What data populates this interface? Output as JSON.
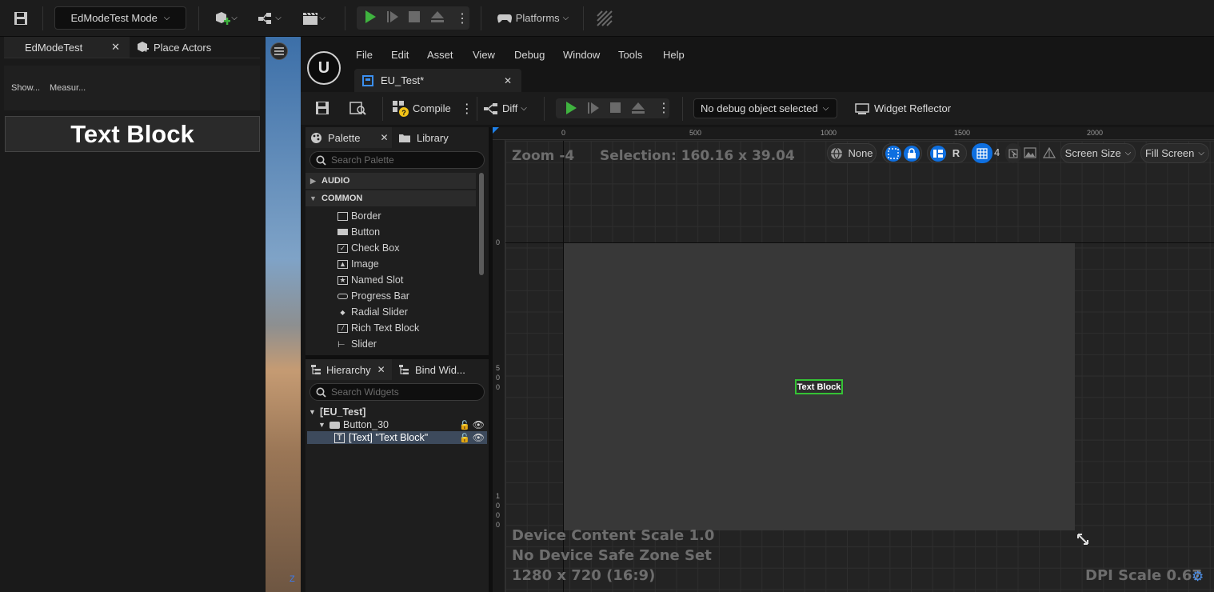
{
  "top_toolbar": {
    "mode_label": "EdModeTest Mode",
    "platforms_label": "Platforms"
  },
  "left_panel": {
    "tab_active": "EdModeTest",
    "tab_place": "Place Actors",
    "tool_show": "Show...",
    "tool_measure": "Measur...",
    "text_block_label": "Text Block"
  },
  "editor": {
    "menu": [
      "File",
      "Edit",
      "Asset",
      "View",
      "Debug",
      "Window",
      "Tools",
      "Help"
    ],
    "doc_tab": "EU_Test*",
    "toolbar": {
      "compile_label": "Compile",
      "diff_label": "Diff",
      "debug_object": "No debug object selected",
      "widget_reflector": "Widget Reflector"
    },
    "palette": {
      "tab": "Palette",
      "library_tab": "Library",
      "search_placeholder": "Search Palette",
      "categories": [
        "AUDIO",
        "COMMON"
      ],
      "items": [
        "Border",
        "Button",
        "Check Box",
        "Image",
        "Named Slot",
        "Progress Bar",
        "Radial Slider",
        "Rich Text Block",
        "Slider"
      ]
    },
    "hierarchy": {
      "tab": "Hierarchy",
      "bind_tab": "Bind Wid...",
      "search_placeholder": "Search Widgets",
      "root": "[EU_Test]",
      "button": "Button_30",
      "text_item": "[Text] \"Text Block\""
    },
    "designer": {
      "zoom": "Zoom -4",
      "selection": "Selection: 160.16 x 39.04",
      "ruler_top": [
        "0",
        "500",
        "1000",
        "1500",
        "2000"
      ],
      "ruler_left": [
        "0",
        "5\n0\n0",
        "1\n0\n0\n0"
      ],
      "toolbar": {
        "none_label": "None",
        "r_label": "R",
        "grid_value": "4",
        "screen_size": "Screen Size",
        "fill_screen": "Fill Screen"
      },
      "widget_text": "Text Block",
      "device_scale": "Device Content Scale 1.0",
      "safe_zone": "No Device Safe Zone Set",
      "resolution": "1280 x 720 (16:9)",
      "dpi_scale": "DPI Scale 0.67"
    }
  },
  "colors": {
    "accent_blue": "#0e6fe0",
    "play_green": "#3fb33f",
    "selection_green": "#35c235"
  }
}
